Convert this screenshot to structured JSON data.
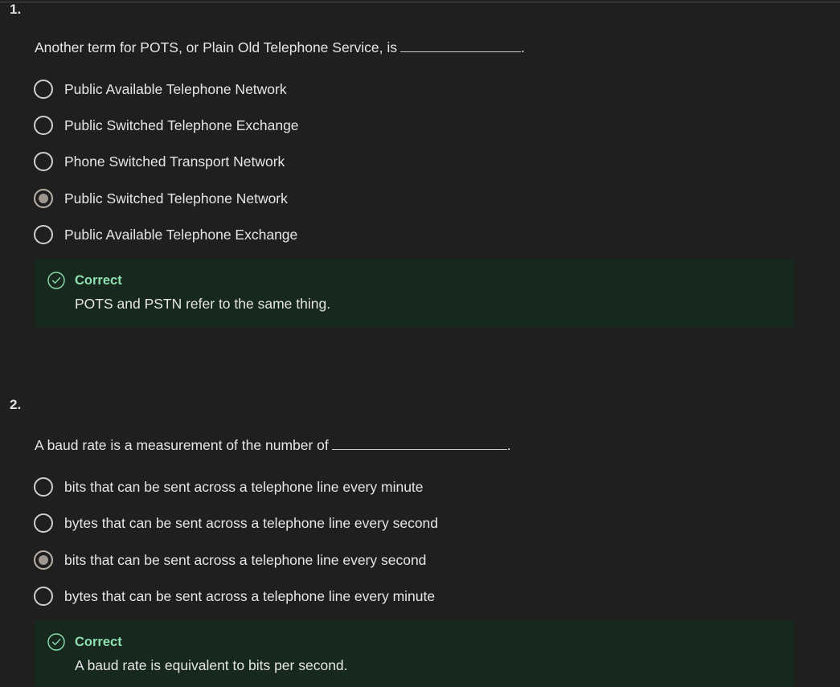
{
  "questions": [
    {
      "number": "1.",
      "prompt": "Another term for POTS, or Plain Old Telephone Service, is",
      "prompt_end": ".",
      "options": [
        {
          "label": "Public Available Telephone Network",
          "selected": false
        },
        {
          "label": "Public Switched Telephone Exchange",
          "selected": false
        },
        {
          "label": "Phone Switched Transport Network",
          "selected": false
        },
        {
          "label": "Public Switched Telephone Network",
          "selected": true
        },
        {
          "label": "Public Available Telephone Exchange",
          "selected": false
        }
      ],
      "feedback": {
        "title": "Correct",
        "text": "POTS and PSTN refer to the same thing.",
        "icon": "check-circle-icon"
      }
    },
    {
      "number": "2.",
      "prompt": "A baud rate is a measurement of the number of",
      "prompt_end": ".",
      "options": [
        {
          "label": "bits that can be sent across a telephone line every minute",
          "selected": false
        },
        {
          "label": "bytes that can be sent across a telephone line every second",
          "selected": false
        },
        {
          "label": "bits that can be sent across a telephone line every second",
          "selected": true
        },
        {
          "label": "bytes that can be sent across a telephone line every minute",
          "selected": false
        }
      ],
      "feedback": {
        "title": "Correct",
        "text": "A baud rate is equivalent to bits per second.",
        "icon": "check-circle-icon"
      }
    }
  ],
  "colors": {
    "background": "#1f1f1f",
    "feedback_background": "#17281f",
    "correct_green": "#8fe0b0",
    "text": "#e6e6e6"
  }
}
